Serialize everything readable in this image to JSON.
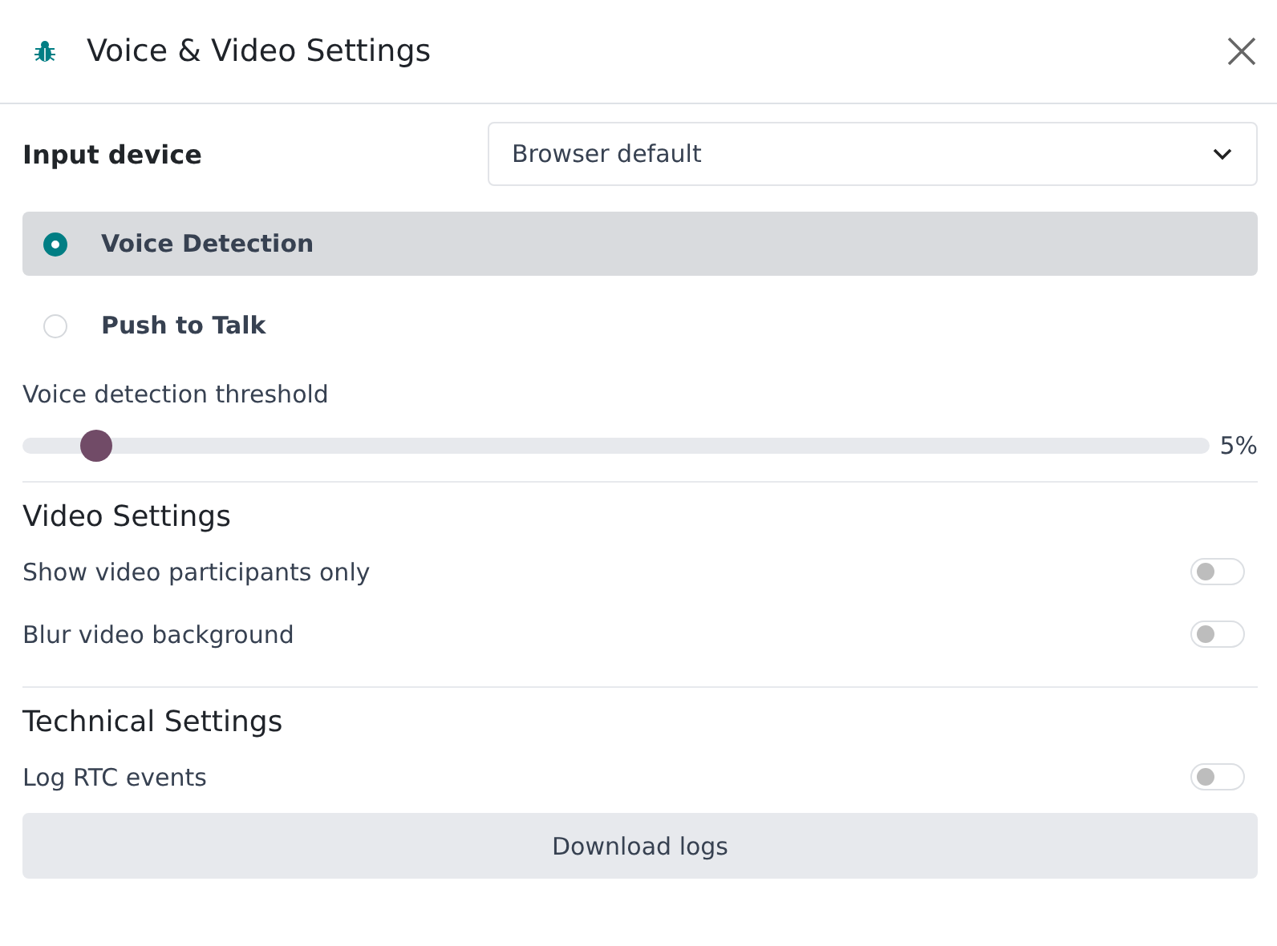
{
  "window": {
    "title": "Voice & Video Settings"
  },
  "input_device": {
    "label": "Input device",
    "value": "Browser default"
  },
  "modes": [
    {
      "label": "Voice Detection",
      "selected": true
    },
    {
      "label": "Push to Talk",
      "selected": false
    }
  ],
  "threshold": {
    "label": "Voice detection threshold",
    "level": 0.05,
    "reading": "5%"
  },
  "sections": [
    {
      "title": "Video Settings",
      "toggles": [
        {
          "label": "Show video participants only",
          "on": false
        },
        {
          "label": "Blur video background",
          "on": false
        }
      ]
    },
    {
      "title": "Technical Settings",
      "toggles": [
        {
          "label": "Log RTC events",
          "on": false
        }
      ],
      "button": "Download logs"
    }
  ]
}
